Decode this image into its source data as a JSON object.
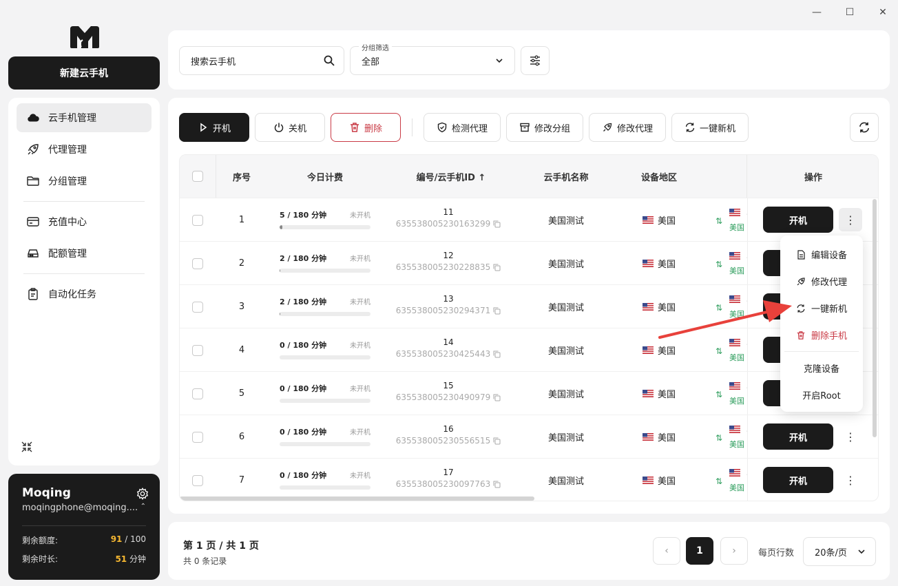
{
  "window": {
    "minimize": "—",
    "maximize": "☐",
    "close": "✕"
  },
  "sidebar": {
    "new_button": "新建云手机",
    "items": [
      {
        "label": "云手机管理",
        "icon": "cloud-icon"
      },
      {
        "label": "代理管理",
        "icon": "rocket-icon"
      },
      {
        "label": "分组管理",
        "icon": "folder-icon"
      },
      {
        "label": "充值中心",
        "icon": "card-icon"
      },
      {
        "label": "配额管理",
        "icon": "drive-icon"
      },
      {
        "label": "自动化任务",
        "icon": "clipboard-icon"
      }
    ]
  },
  "user": {
    "name": "Moqing",
    "email": "moqingphone@moqing....",
    "quota_label": "剩余额度:",
    "quota_used": "91",
    "quota_total": "/ 100",
    "time_label": "剩余时长:",
    "time_value": "51",
    "time_unit": "分钟"
  },
  "search": {
    "placeholder": "搜索云手机"
  },
  "group_filter": {
    "label": "分组筛选",
    "value": "全部"
  },
  "toolbar": {
    "start": "开机",
    "shutdown": "关机",
    "delete": "删除",
    "check_proxy": "检测代理",
    "edit_group": "修改分组",
    "edit_proxy": "修改代理",
    "renew": "一键新机"
  },
  "table": {
    "headers": {
      "seq": "序号",
      "fee": "今日计费",
      "id": "编号/云手机ID ↑",
      "name": "云手机名称",
      "region": "设备地区",
      "action": "操作"
    },
    "rows": [
      {
        "seq": "1",
        "fee": "5 / 180 分钟",
        "fee_pct": 3,
        "status": "未开机",
        "num": "11",
        "pid": "635538005230163299",
        "name": "美国测试",
        "region": "美国",
        "partial_top": "3",
        "partial_bot": "美国",
        "open": "开机"
      },
      {
        "seq": "2",
        "fee": "2 / 180 分钟",
        "fee_pct": 1,
        "status": "未开机",
        "num": "12",
        "pid": "635538005230228835",
        "name": "美国测试",
        "region": "美国",
        "partial_top": "3",
        "partial_bot": "美国",
        "open": "开机"
      },
      {
        "seq": "3",
        "fee": "2 / 180 分钟",
        "fee_pct": 1,
        "status": "未开机",
        "num": "13",
        "pid": "635538005230294371",
        "name": "美国测试",
        "region": "美国",
        "partial_top": "3",
        "partial_bot": "美国",
        "open": "开机"
      },
      {
        "seq": "4",
        "fee": "0 / 180 分钟",
        "fee_pct": 0,
        "status": "未开机",
        "num": "14",
        "pid": "635538005230425443",
        "name": "美国测试",
        "region": "美国",
        "partial_top": "3",
        "partial_bot": "美国",
        "open": "开机"
      },
      {
        "seq": "5",
        "fee": "0 / 180 分钟",
        "fee_pct": 0,
        "status": "未开机",
        "num": "15",
        "pid": "635538005230490979",
        "name": "美国测试",
        "region": "美国",
        "partial_top": "3",
        "partial_bot": "美国",
        "open": "开机"
      },
      {
        "seq": "6",
        "fee": "0 / 180 分钟",
        "fee_pct": 0,
        "status": "未开机",
        "num": "16",
        "pid": "635538005230556515",
        "name": "美国测试",
        "region": "美国",
        "partial_top": "3",
        "partial_bot": "美国",
        "open": "开机"
      },
      {
        "seq": "7",
        "fee": "0 / 180 分钟",
        "fee_pct": 0,
        "status": "未开机",
        "num": "17",
        "pid": "635538005230097763",
        "name": "美国测试",
        "region": "美国",
        "partial_top": "3",
        "partial_bot": "美国",
        "open": "开机"
      }
    ]
  },
  "menu": {
    "edit_device": "编辑设备",
    "edit_proxy": "修改代理",
    "renew": "一键新机",
    "delete_phone": "删除手机",
    "clone": "克隆设备",
    "root": "开启Root"
  },
  "pager": {
    "title": "第 1 页 / 共 1 页",
    "total": "共 0 条记录",
    "prev": "‹",
    "current": "1",
    "next": "›",
    "rows_label": "每页行数",
    "rows_value": "20条/页"
  },
  "colors": {
    "accent": "#1b1b1b",
    "danger": "#c93a45",
    "quota": "#f5b731",
    "green": "#2f9e5e",
    "annotation": "#e8413b"
  }
}
